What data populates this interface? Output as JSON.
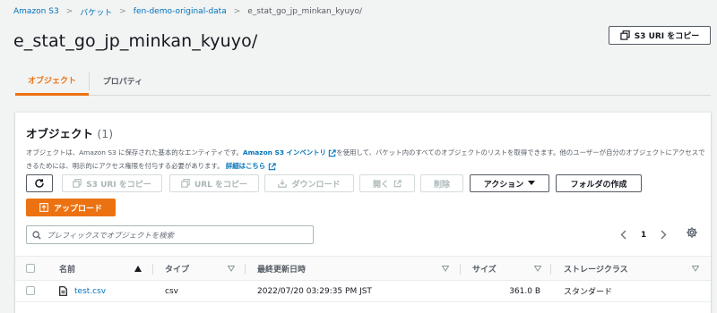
{
  "breadcrumb": {
    "items": [
      "Amazon S3",
      "バケット",
      "fen-demo-original-data"
    ],
    "current": "e_stat_go_jp_minkan_kyuyo/"
  },
  "page_title": "e_stat_go_jp_minkan_kyuyo/",
  "copy_s3_uri_top_label": "S3 URI をコピー",
  "tabs": [
    {
      "label": "オブジェクト",
      "active": true
    },
    {
      "label": "プロパティ",
      "active": false
    }
  ],
  "objects_panel": {
    "title": "オブジェクト",
    "count": "(1)",
    "desc_part1": "オブジェクトは、Amazon S3 に保存された基本的なエンティティです。",
    "desc_link1": "Amazon S3 インベントリ",
    "desc_part2": "を使用して、バケット内のすべてのオブジェクトのリストを取得できます。他のユーザーが自分のオブジェクトにアクセスできるためには、明示的にアクセス権限を付与する必要があります。",
    "desc_link2": "詳細はこちら"
  },
  "toolbar": {
    "copy_s3_uri": "S3 URI をコピー",
    "copy_url": "URL をコピー",
    "download": "ダウンロード",
    "open": "開く",
    "delete": "削除",
    "actions": "アクション",
    "create_folder": "フォルダの作成",
    "upload": "アップロード"
  },
  "search": {
    "placeholder": "プレフィックスでオブジェクトを検索"
  },
  "pagination": {
    "page": "1"
  },
  "table": {
    "columns": [
      "名前",
      "タイプ",
      "最終更新日時",
      "サイズ",
      "ストレージクラス"
    ],
    "rows": [
      {
        "name": "test.csv",
        "type": "csv",
        "last_modified": "2022/07/20 03:29:35 PM JST",
        "size": "361.0 B",
        "storage_class": "スタンダード"
      }
    ]
  },
  "colors": {
    "accent": "#ec7211",
    "link": "#0073bb",
    "text": "#16191f"
  }
}
